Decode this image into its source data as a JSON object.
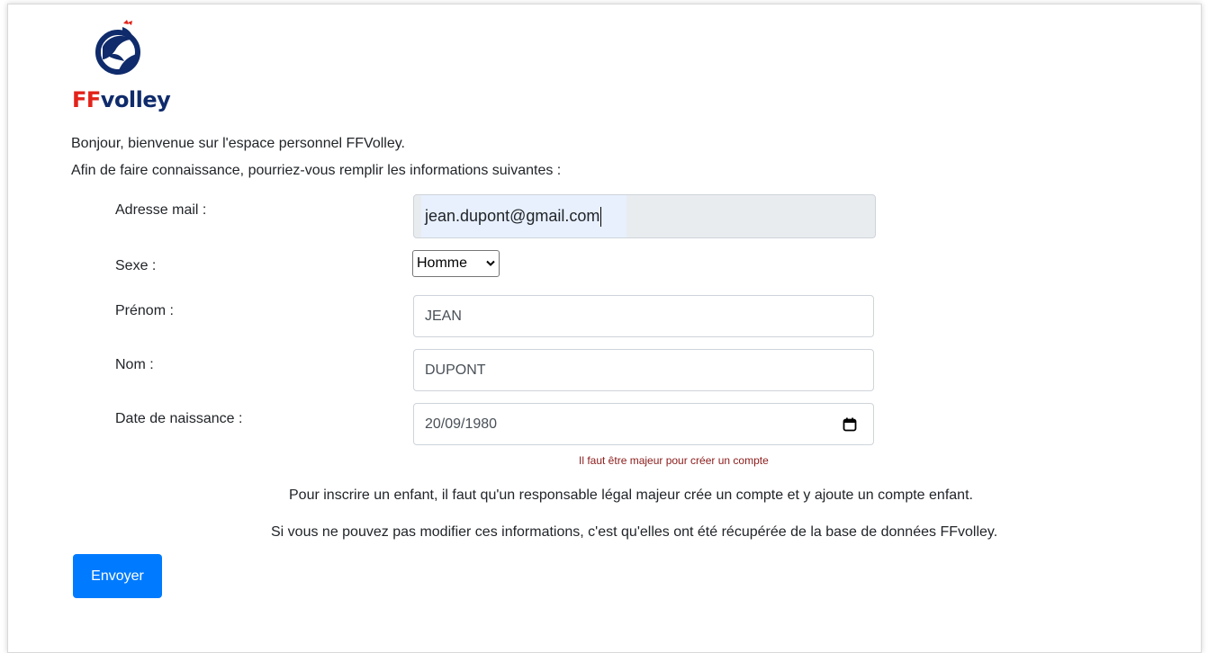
{
  "brand": {
    "logo_prefix": "FF",
    "logo_suffix": "volley",
    "colors": {
      "red": "#e2231a",
      "navy": "#0f2b6b"
    }
  },
  "intro": {
    "line1": "Bonjour, bienvenue sur l'espace personnel FFVolley.",
    "line2": "Afin de faire connaissance, pourriez-vous remplir les informations suivantes :"
  },
  "form": {
    "email": {
      "label": "Adresse mail :",
      "value": "jean.dupont@gmail.com"
    },
    "sexe": {
      "label": "Sexe :",
      "selected": "Homme"
    },
    "prenom": {
      "label": "Prénom :",
      "value": "JEAN"
    },
    "nom": {
      "label": "Nom :",
      "value": "DUPONT"
    },
    "naissance": {
      "label": "Date de naissance :",
      "value": "20/09/1980",
      "icon": "calendar-icon"
    },
    "hint": "Il faut être majeur pour créer un compte",
    "submit_label": "Envoyer"
  },
  "notes": {
    "child": "Pour inscrire un enfant, il faut qu'un responsable légal majeur crée un compte et y ajoute un compte enfant.",
    "readonly": "Si vous ne pouvez pas modifier ces informations, c'est qu'elles ont été récupérée de la base de données FFvolley."
  },
  "colors": {
    "primary": "#007bff",
    "hint": "#8b1a1a",
    "readonly_bg": "#e9ecef"
  }
}
